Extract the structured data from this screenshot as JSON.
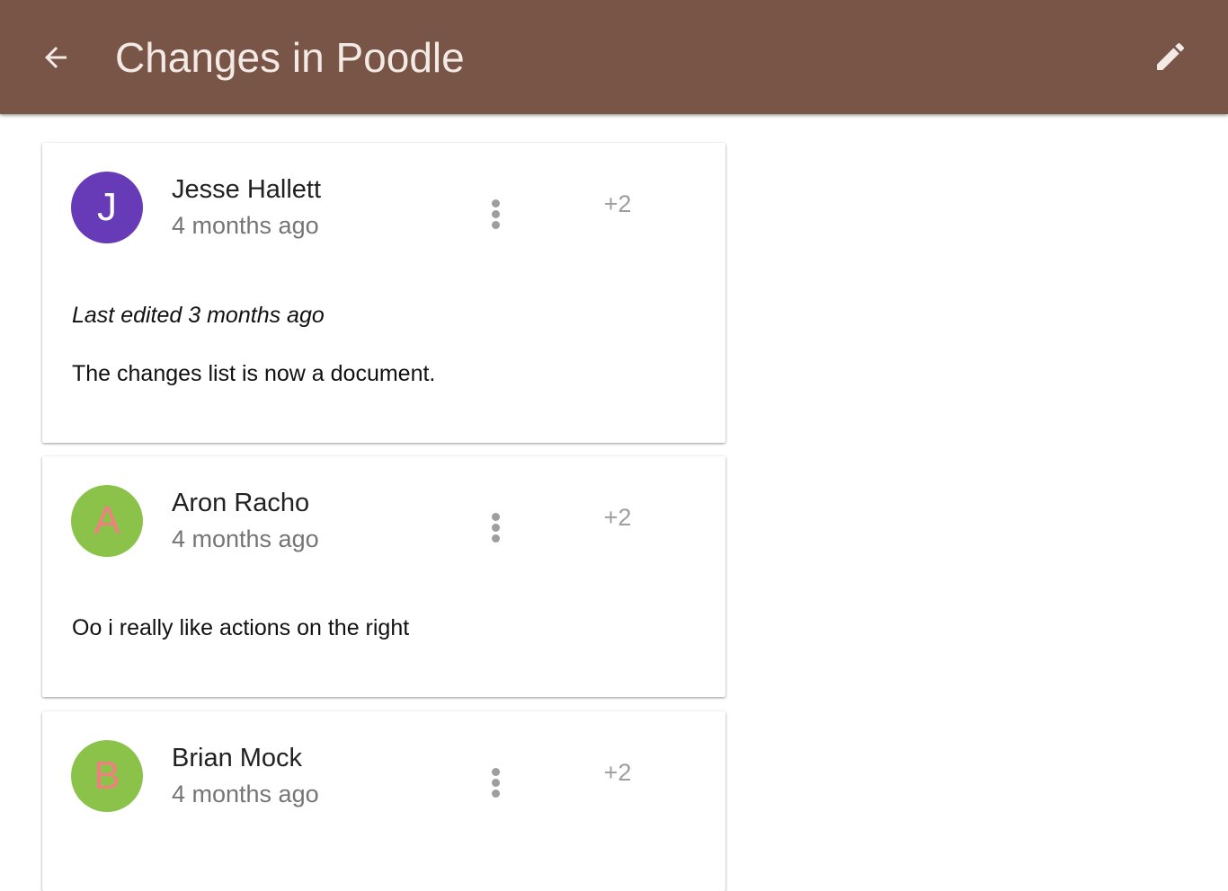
{
  "header": {
    "title": "Changes in Poodle",
    "back_icon": "arrow-back-icon",
    "edit_icon": "pencil-icon",
    "background_color": "#795548"
  },
  "comments": [
    {
      "avatar_letter": "J",
      "avatar_bg": "#673ab7",
      "avatar_fg": "#ffffff",
      "author": "Jesse Hallett",
      "time": "4 months ago",
      "menu_icon": "more-vert-icon",
      "plus_count": "+2",
      "edited_note": "Last edited 3 months ago",
      "text": "The changes list is now a document."
    },
    {
      "avatar_letter": "A",
      "avatar_bg": "#8bc34a",
      "avatar_fg": "#f08080",
      "author": "Aron Racho",
      "time": "4 months ago",
      "menu_icon": "more-vert-icon",
      "plus_count": "+2",
      "text": "Oo i really like actions on the right"
    },
    {
      "avatar_letter": "B",
      "avatar_bg": "#8bc34a",
      "avatar_fg": "#f08080",
      "author": "Brian Mock",
      "time": "4 months ago",
      "menu_icon": "more-vert-icon",
      "plus_count": "+2"
    }
  ]
}
